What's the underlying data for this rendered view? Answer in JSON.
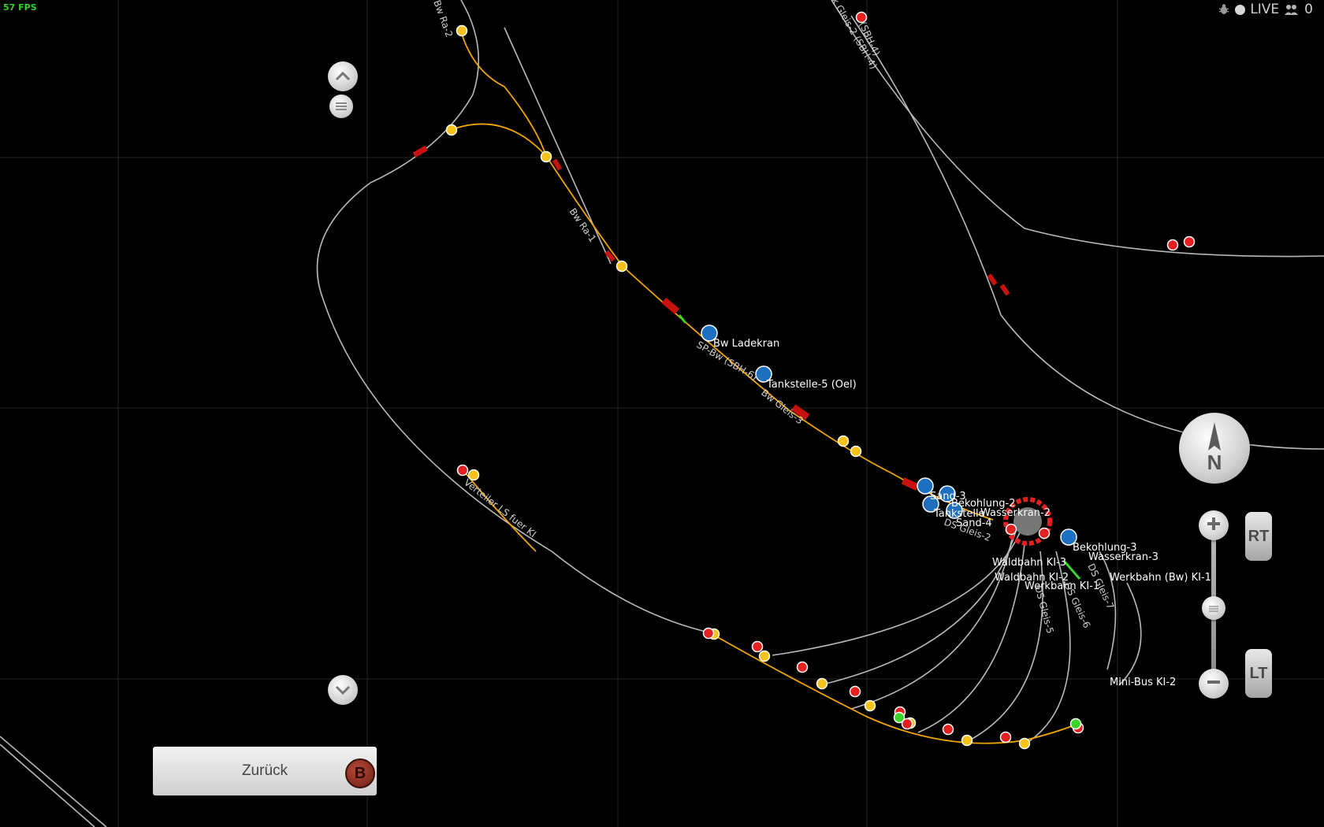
{
  "hud": {
    "fps": "57 FPS",
    "live": "LIVE",
    "player_count": "0"
  },
  "compass": {
    "letter": "N"
  },
  "triggers": {
    "rt": "RT",
    "lt": "LT"
  },
  "back_button": {
    "label": "Zurück",
    "icon_letter": "B"
  },
  "zoom": {
    "level": 0.52
  },
  "map_labels": {
    "bw_ladekran": "Bw Ladekran",
    "tankstelle_5": "Tankstelle-5 (Oel)",
    "sand_3": "Sand-3",
    "bekohlung_2": "Bekohlung-2",
    "tankstelle_x": "Tankstelle",
    "wasserkran_2": "Wasserkran-2",
    "sand_4": "Sand-4",
    "bekohlung_3": "Bekohlung-3",
    "wasserkran_3": "Wasserkran-3",
    "werkbahn_bw_ki1": "Werkbahn (Bw) KI-1",
    "waldbahn_ki3": "Waldbahn KI-3",
    "waldbahn_ki2": "Waldbahn KI-2",
    "werkbahn_ki1": "Werkbahn KI-1",
    "mini_bus_ki2": "Mini-Bus KI-2"
  },
  "track_labels": {
    "bw_ra_1": "Bw Ra-1",
    "bw_ra_2": "Bw Ra-2",
    "sp_bw": "SP-Bw (SBH-6)",
    "bw_gleis_3": "Bw Gleis-3",
    "ds_gleis_2": "DS Gleis-2",
    "ds_gleis_5": "DS Gleis-5",
    "ds_gleis_6": "DS Gleis-6",
    "ds_gleis_7": "DS Gleis-7",
    "verteiler": "Verteiler LS fuer KI",
    "gleis_2_sbh4": "k Gleis-2 (SBH-4)",
    "sbh_4": "(SBH-4)"
  },
  "colors": {
    "track": "#b9b9b9",
    "orange": "#f0a500",
    "red_signal": "#e52020",
    "yellow_signal": "#f7c21b",
    "green": "#3bd42a",
    "grid": "#2a2a2a"
  }
}
